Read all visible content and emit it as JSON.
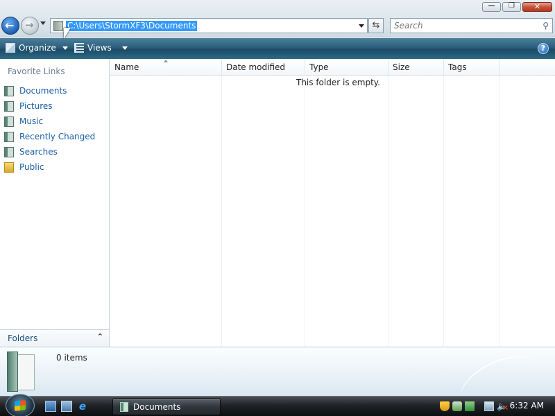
{
  "window": {
    "minimize_glyph": "—",
    "maximize_glyph": "❐",
    "close_glyph": "✕"
  },
  "address": {
    "path": "C:\\Users\\StormXF3\\Documents"
  },
  "search": {
    "placeholder": "Search"
  },
  "toolbar": {
    "organize_label": "Organize",
    "views_label": "Views",
    "help_glyph": "?"
  },
  "navpane": {
    "favorites_title": "Favorite Links",
    "items": [
      {
        "label": "Documents",
        "icon": "documents-icon"
      },
      {
        "label": "Pictures",
        "icon": "pictures-icon"
      },
      {
        "label": "Music",
        "icon": "music-icon"
      },
      {
        "label": "Recently Changed",
        "icon": "recently-changed-icon"
      },
      {
        "label": "Searches",
        "icon": "searches-icon"
      },
      {
        "label": "Public",
        "icon": "public-folder-icon"
      }
    ],
    "folders_label": "Folders"
  },
  "filelist": {
    "columns": [
      "Name",
      "Date modified",
      "Type",
      "Size",
      "Tags"
    ],
    "empty_message": "This folder is empty."
  },
  "details": {
    "item_count": "0 items"
  },
  "taskbar": {
    "task_label": "Documents",
    "clock": "6:32 AM"
  },
  "colors": {
    "toolbar": "#2a5f7d",
    "link": "#1b5fa6",
    "selection": "#3399ff"
  }
}
